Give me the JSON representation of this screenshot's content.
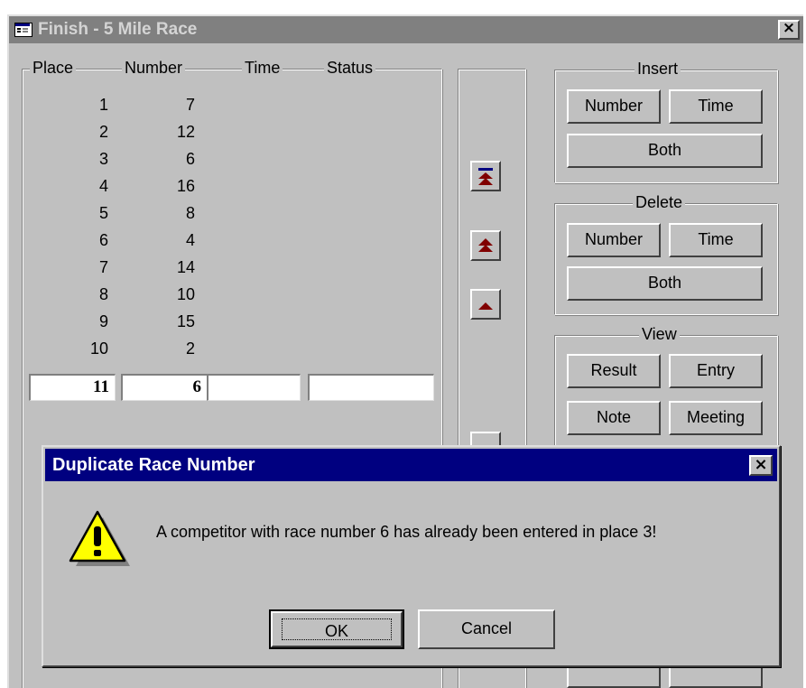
{
  "window": {
    "title": "Finish - 5 Mile Race",
    "close_glyph": "×"
  },
  "results": {
    "headers": {
      "place": "Place",
      "number": "Number",
      "time": "Time",
      "status": "Status"
    },
    "rows": [
      {
        "place": "1",
        "number": "7"
      },
      {
        "place": "2",
        "number": "12"
      },
      {
        "place": "3",
        "number": "6"
      },
      {
        "place": "4",
        "number": "16"
      },
      {
        "place": "5",
        "number": "8"
      },
      {
        "place": "6",
        "number": "4"
      },
      {
        "place": "7",
        "number": "14"
      },
      {
        "place": "8",
        "number": "10"
      },
      {
        "place": "9",
        "number": "15"
      },
      {
        "place": "10",
        "number": "2"
      }
    ],
    "entry": {
      "place": "11",
      "number": "6",
      "time": "",
      "status": ""
    }
  },
  "nav": {
    "icons": [
      "move-to-top-icon",
      "move-up-fast-icon",
      "move-up-icon"
    ],
    "icon_color": "#800000"
  },
  "insert": {
    "label": "Insert",
    "number": "Number",
    "time": "Time",
    "both": "Both"
  },
  "delete": {
    "label": "Delete",
    "number": "Number",
    "time": "Time",
    "both": "Both"
  },
  "view": {
    "label": "View",
    "result": "Result",
    "entry": "Entry",
    "note": "Note",
    "meeting": "Meeting"
  },
  "dialog": {
    "title": "Duplicate Race Number",
    "close_glyph": "×",
    "message": "A competitor with race number 6 has already been entered in place 3!",
    "icon": "warning-icon",
    "ok": "OK",
    "cancel": "Cancel"
  },
  "colors": {
    "face": "#c0c0c0",
    "active_titlebar": "#000080",
    "inactive_titlebar": "#808080",
    "warning_yellow": "#ffff00"
  }
}
